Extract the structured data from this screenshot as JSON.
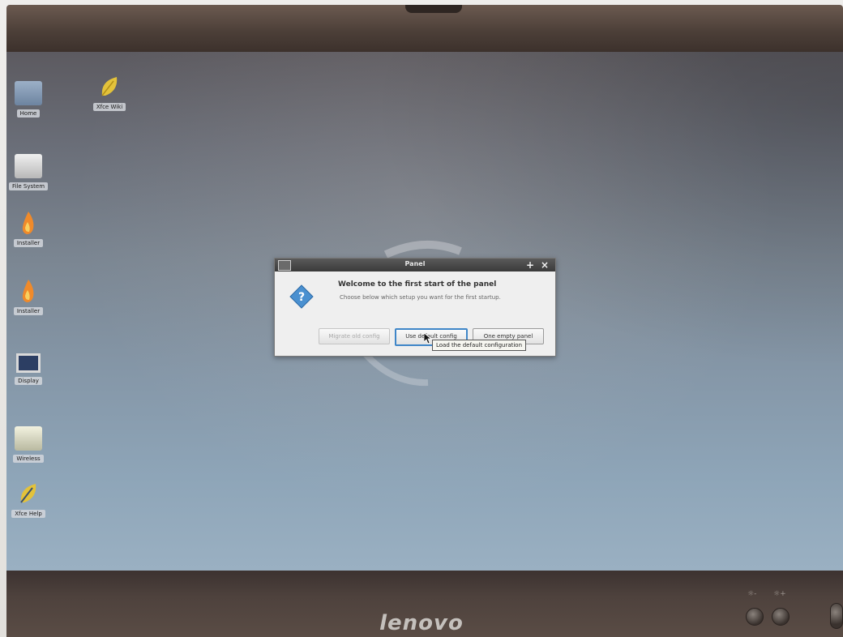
{
  "bezel": {
    "brand": "lenovo"
  },
  "desktop": {
    "icons": [
      {
        "name": "folder-icon",
        "label": "Home"
      },
      {
        "name": "leaf-icon",
        "label": "Xfce Wiki"
      },
      {
        "name": "drive-icon",
        "label": "File System"
      },
      {
        "name": "flame-icon",
        "label": "Installer"
      },
      {
        "name": "flame-icon",
        "label": "Installer"
      },
      {
        "name": "monitor-icon",
        "label": "Display"
      },
      {
        "name": "drive-icon",
        "label": "Wireless"
      },
      {
        "name": "leaf-icon",
        "label": "Xfce Help"
      }
    ]
  },
  "dialog": {
    "title": "Panel",
    "heading": "Welcome to the first start of the panel",
    "subtext": "Choose below which setup you want for the first startup.",
    "buttons": [
      {
        "label": "Migrate old config",
        "state": "disabled"
      },
      {
        "label": "Use default config",
        "state": "focused"
      },
      {
        "label": "One empty panel",
        "state": "normal"
      }
    ],
    "tooltip": "Load the default configuration"
  },
  "colors": {
    "focus_ring": "#3f86c8",
    "title_bar": "#3a3a3a",
    "question_icon": "#4a90d0"
  }
}
